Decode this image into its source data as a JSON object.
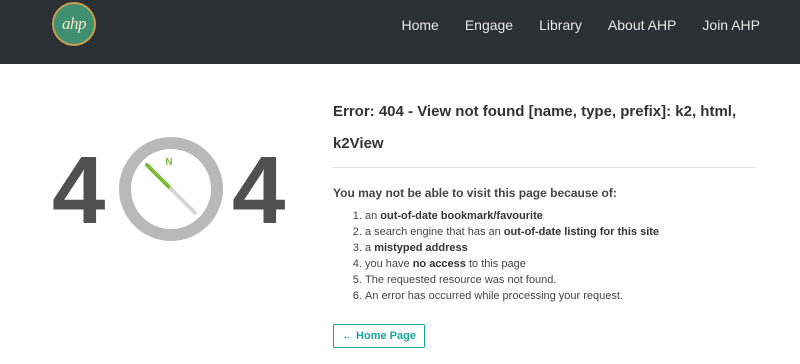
{
  "header": {
    "logo_text": "ahp",
    "nav": [
      {
        "label": "Home"
      },
      {
        "label": "Engage"
      },
      {
        "label": "Library"
      },
      {
        "label": "About AHP"
      },
      {
        "label": "Join AHP"
      }
    ]
  },
  "graphic": {
    "left_digit": "4",
    "right_digit": "4",
    "compass_letter": "N",
    "colors": {
      "digits": "#505050",
      "ring": "#b9b9b9",
      "needle": "#7dbb3a"
    }
  },
  "error": {
    "title": "Error: 404 - View not found [name, type, prefix]: k2, html, k2View",
    "subtitle": "You may not be able to visit this page because of:",
    "reasons": [
      {
        "pre": "an ",
        "bold": "out-of-date bookmark/favourite",
        "post": ""
      },
      {
        "pre": "a search engine that has an ",
        "bold": "out-of-date listing for this site",
        "post": ""
      },
      {
        "pre": "a ",
        "bold": "mistyped address",
        "post": ""
      },
      {
        "pre": "you have ",
        "bold": "no access",
        "post": " to this page"
      },
      {
        "pre": "The requested resource was not found.",
        "bold": "",
        "post": ""
      },
      {
        "pre": "An error has occurred while processing your request.",
        "bold": "",
        "post": ""
      }
    ],
    "home_button": "← Home Page"
  },
  "colors": {
    "navbar": "#2b2f36",
    "accent": "#1aa39b"
  }
}
